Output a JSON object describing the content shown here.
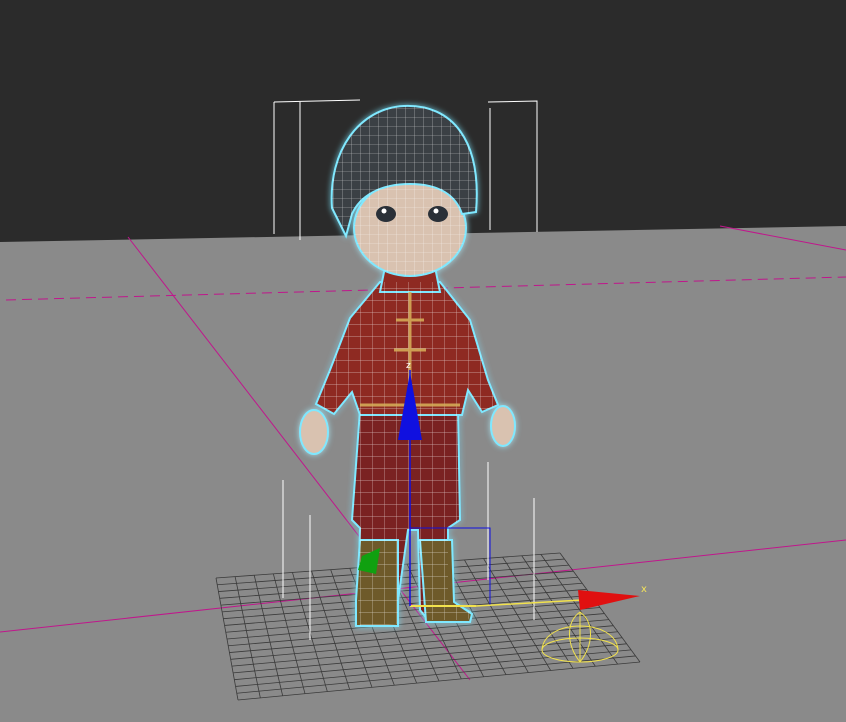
{
  "viewport": {
    "background_top": "#2b2b2b",
    "ground_color": "#8a8a8a",
    "selection_glow": "#7fe8ff",
    "wire_color": "#ffffff"
  },
  "gizmo": {
    "x_label": "x",
    "z_label": "z",
    "x_axis_color": "#e01010",
    "z_axis_color": "#1010e0",
    "y_axis_color": "#10a010",
    "active_plane_color": "#f2e24d"
  },
  "character": {
    "icon": "character-mesh-icon",
    "outfit_color": "#8e2a24",
    "trim_color": "#d8b25a",
    "hair_color": "#3a3f45",
    "skin_color": "#d9c2b0"
  }
}
